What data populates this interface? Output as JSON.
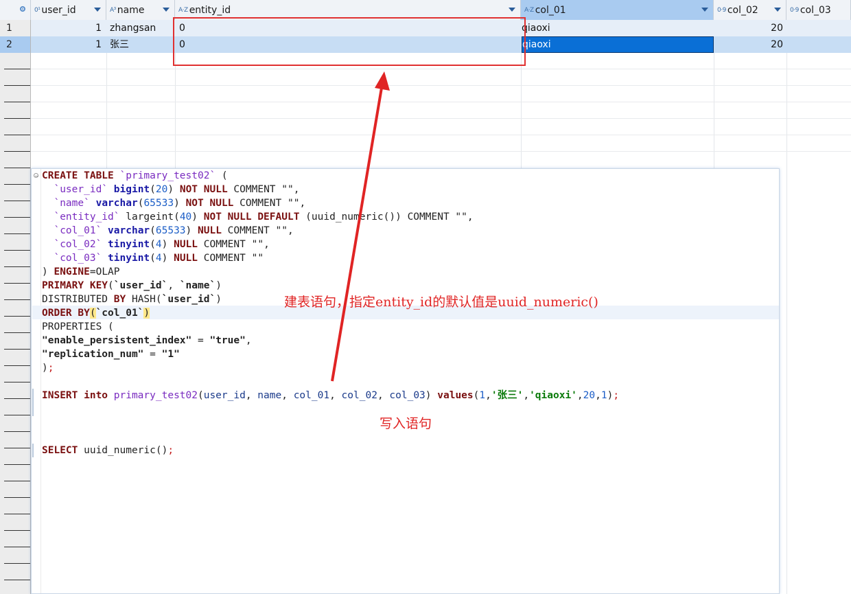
{
  "grid": {
    "columns": [
      {
        "label": "user_id",
        "type_icon": "0¹",
        "icon": "numeric-type-icon"
      },
      {
        "label": "name",
        "type_icon": "A³",
        "icon": "text-type-icon"
      },
      {
        "label": "entity_id",
        "type_icon": "A·Z",
        "icon": "text-type-icon"
      },
      {
        "label": "col_01",
        "type_icon": "A·Z",
        "icon": "text-type-icon"
      },
      {
        "label": "col_02",
        "type_icon": "0·9",
        "icon": "numeric-type-icon"
      },
      {
        "label": "col_03",
        "type_icon": "0·9",
        "icon": "numeric-type-icon"
      }
    ],
    "rows": [
      {
        "num": "1",
        "user_id": "1",
        "name": "zhangsan",
        "entity_id": "0",
        "col_01": "qiaoxi",
        "col_02": "20"
      },
      {
        "num": "2",
        "user_id": "1",
        "name": "张三",
        "entity_id": "0",
        "col_01": "qiaoxi",
        "col_02": "20"
      }
    ]
  },
  "editor": {
    "lines": [
      "CREATE TABLE `primary_test02` (",
      "  `user_id` bigint(20) NOT NULL COMMENT \"\",",
      "  `name` varchar(65533) NOT NULL COMMENT \"\",",
      "  `entity_id` largeint(40) NOT NULL DEFAULT (uuid_numeric()) COMMENT \"\",",
      "  `col_01` varchar(65533) NULL COMMENT \"\",",
      "  `col_02` tinyint(4) NULL COMMENT \"\",",
      "  `col_03` tinyint(4) NULL COMMENT \"\"",
      ") ENGINE=OLAP",
      "PRIMARY KEY(`user_id`, `name`)",
      "DISTRIBUTED BY HASH(`user_id`)",
      "ORDER BY(`col_01`)",
      "PROPERTIES (",
      "\"enable_persistent_index\" = \"true\",",
      "\"replication_num\" = \"1\"",
      ");",
      "INSERT into primary_test02(user_id, name, col_01, col_02, col_03) values(1,'张三','qiaoxi',20,1);",
      "SELECT uuid_numeric();"
    ]
  },
  "annotations": {
    "create_note": "建表语句，指定entity_id的默认值是uuid_numeric()",
    "insert_note": "写入语句"
  },
  "colors": {
    "annotation": "#e02424",
    "selection": "#0a6fd6",
    "header_active": "#a9cbf0"
  }
}
